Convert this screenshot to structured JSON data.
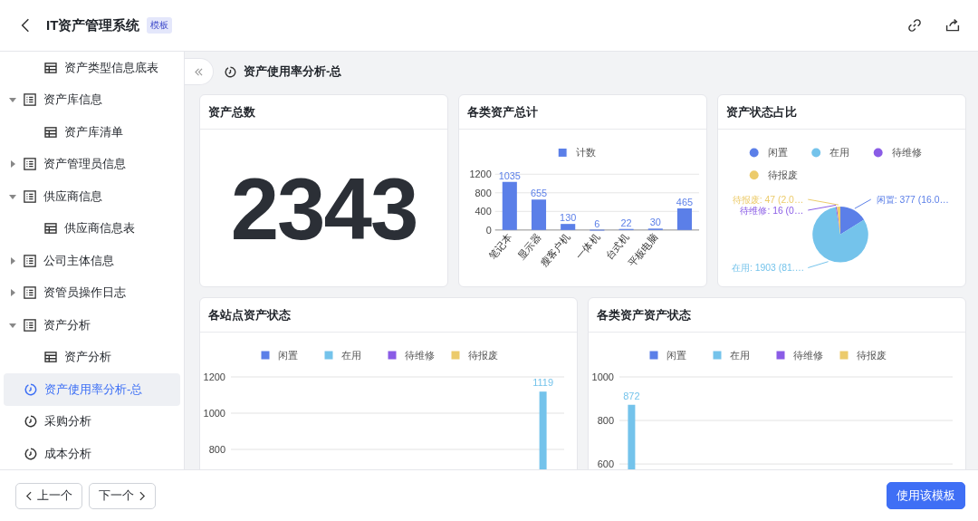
{
  "header": {
    "title": "IT资产管理系统",
    "badge": "模板"
  },
  "sidebar": {
    "items": [
      {
        "label": "资产类型信息底表",
        "kind": "table",
        "selected": false
      },
      {
        "label": "资产库信息",
        "kind": "group",
        "expanded": true,
        "selected": false,
        "children": [
          {
            "label": "资产库清单",
            "kind": "table",
            "selected": false
          }
        ]
      },
      {
        "label": "资产管理员信息",
        "kind": "group",
        "expanded": false,
        "selected": false
      },
      {
        "label": "供应商信息",
        "kind": "group",
        "expanded": true,
        "selected": false,
        "children": [
          {
            "label": "供应商信息表",
            "kind": "table",
            "selected": false
          }
        ]
      },
      {
        "label": "公司主体信息",
        "kind": "group",
        "expanded": false,
        "selected": false
      },
      {
        "label": "资管员操作日志",
        "kind": "group",
        "expanded": false,
        "selected": false
      },
      {
        "label": "资产分析",
        "kind": "group",
        "expanded": true,
        "selected": false,
        "children": [
          {
            "label": "资产分析",
            "kind": "table",
            "selected": false
          }
        ]
      },
      {
        "label": "资产使用率分析-总",
        "kind": "analysis",
        "selected": true
      },
      {
        "label": "采购分析",
        "kind": "analysis",
        "selected": false
      },
      {
        "label": "成本分析",
        "kind": "analysis",
        "selected": false
      }
    ]
  },
  "breadcrumb": "资产使用率分析-总",
  "cards": [
    {
      "title": "资产总数",
      "kind": "number",
      "value": "2343"
    },
    {
      "title": "各类资产总计",
      "kind": "bar",
      "chart_data": {
        "type": "bar",
        "categories": [
          "笔记本",
          "显示器",
          "瘦客户机",
          "一体机",
          "台式机",
          "平板电脑",
          null
        ],
        "series": [
          {
            "name": "计数",
            "color": "#5b7fe8",
            "values": [
              1035,
              655,
              130,
              6,
              22,
              30,
              465
            ]
          }
        ],
        "ylim": [
          0,
          1200
        ],
        "yticks": [
          0,
          400,
          800,
          1200
        ],
        "data_labels": true,
        "legend": "top"
      }
    },
    {
      "title": "资产状态占比",
      "kind": "pie",
      "chart_data": {
        "type": "pie",
        "categories": [
          "闲置",
          "在用",
          "待维修",
          "待报废"
        ],
        "values": [
          16.09,
          81.22,
          0.68,
          2.01
        ],
        "legend": "top",
        "colors": [
          "#5b7fe8",
          "#74c3eb",
          "#8a5ce6",
          "#eccb6b"
        ],
        "annotations": [
          "闲置: 377 (16.0…",
          "在用: 1903 (81.…",
          "待维修: 16 (0…",
          "待报废: 47 (2.0…"
        ]
      }
    },
    {
      "title": "各站点资产状态",
      "kind": "grouped",
      "chart_data": {
        "type": "bar",
        "series": [
          {
            "name": "闲置",
            "color": "#5b7fe8",
            "values": [
              null,
              null,
              null,
              null,
              null,
              null,
              null,
              null,
              null,
              null
            ]
          },
          {
            "name": "在用",
            "color": "#74c3eb",
            "values": [
              null,
              null,
              null,
              null,
              null,
              null,
              null,
              null,
              null,
              1119
            ]
          },
          {
            "name": "待维修",
            "color": "#8a5ce6",
            "values": [
              null,
              null,
              null,
              null,
              null,
              null,
              null,
              null,
              null,
              null
            ]
          },
          {
            "name": "待报废",
            "color": "#eccb6b",
            "values": [
              null,
              null,
              null,
              null,
              null,
              null,
              null,
              null,
              null,
              null
            ]
          }
        ],
        "ylim": [
          680,
          1200
        ],
        "yticks": [
          800,
          1000,
          1200
        ],
        "data_labels": true,
        "legend": "top"
      }
    },
    {
      "title": "各类资产资产状态",
      "kind": "grouped",
      "chart_data": {
        "type": "bar",
        "series": [
          {
            "name": "闲置",
            "color": "#5b7fe8",
            "values": [
              null,
              null,
              null,
              null
            ]
          },
          {
            "name": "在用",
            "color": "#74c3eb",
            "values": [
              872,
              null,
              null,
              null
            ]
          },
          {
            "name": "待维修",
            "color": "#8a5ce6",
            "values": [
              null,
              null,
              null,
              null
            ]
          },
          {
            "name": "待报废",
            "color": "#eccb6b",
            "values": [
              null,
              null,
              null,
              null
            ]
          }
        ],
        "ylim": [
          567,
          1000
        ],
        "yticks": [
          600,
          800,
          1000
        ],
        "data_labels": true,
        "legend": "top"
      }
    }
  ],
  "footer": {
    "prev": "上一个",
    "next": "下一个",
    "primary": "使用该模板"
  }
}
